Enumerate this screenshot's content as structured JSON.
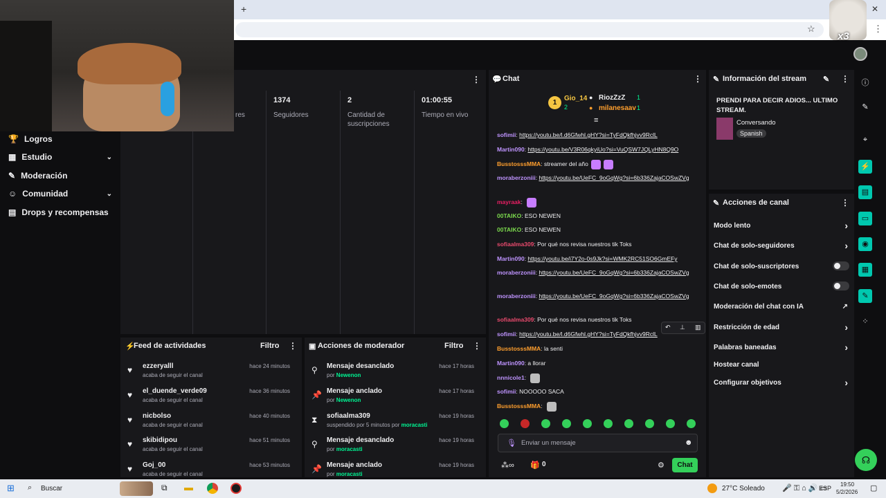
{
  "browser": {
    "new_tab": "+",
    "close": "✕",
    "minimize": "—"
  },
  "sidebar": {
    "items": [
      {
        "label": "Logros",
        "icon": "trophy-icon",
        "chevron": false
      },
      {
        "label": "Estudio",
        "icon": "studio-icon",
        "chevron": true
      },
      {
        "label": "Moderación",
        "icon": "wrench-icon",
        "chevron": false
      },
      {
        "label": "Comunidad",
        "icon": "community-icon",
        "chevron": true
      },
      {
        "label": "Drops y recompensas",
        "icon": "drops-icon",
        "chevron": false
      }
    ]
  },
  "stats": {
    "partial_label": "res",
    "items": [
      {
        "value": "1374",
        "label": "Seguidores"
      },
      {
        "value": "2",
        "label": "Cantidad de suscripciones"
      },
      {
        "value": "01:00:55",
        "label": "Tiempo en vivo"
      }
    ]
  },
  "activity_feed": {
    "title": "Feed de actividades",
    "filter": "Filtro",
    "items": [
      {
        "name": "ezzeryalll",
        "sub": "acaba de seguir el canal",
        "time": "hace 24 minutos"
      },
      {
        "name": "el_duende_verde09",
        "sub": "acaba de seguir el canal",
        "time": "hace 36 minutos"
      },
      {
        "name": "nicbolso",
        "sub": "acaba de seguir el canal",
        "time": "hace 40 minutos"
      },
      {
        "name": "skibidipou",
        "sub": "acaba de seguir el canal",
        "time": "hace 51 minutos"
      },
      {
        "name": "Goj_00",
        "sub": "acaba de seguir el canal",
        "time": "hace 53 minutos"
      }
    ]
  },
  "mod_actions": {
    "title": "Acciones de moderador",
    "filter": "Filtro",
    "items": [
      {
        "title": "Mensaje desanclado",
        "by": "por ",
        "actor": "Newenon",
        "time": "hace 17 horas"
      },
      {
        "title": "Mensaje anclado",
        "by": "por ",
        "actor": "Newenon",
        "time": "hace 17 horas"
      },
      {
        "title": "sofiaalma309",
        "by": "suspendido por 5 minutos por ",
        "actor": "moracasti",
        "time": "hace 19 horas"
      },
      {
        "title": "Mensaje desanclado",
        "by": "por ",
        "actor": "moracasti",
        "time": "hace 19 horas"
      },
      {
        "title": "Mensaje anclado",
        "by": "por ",
        "actor": "moracasti",
        "time": "hace 19 horas"
      }
    ]
  },
  "chat": {
    "title": "Chat",
    "leaderboard": {
      "rank": "1",
      "left_name": "Gio_14",
      "left_count": "2",
      "right": [
        {
          "name": "RiozZzZ",
          "count": "1"
        },
        {
          "name": "milanesaav",
          "count": "1"
        }
      ]
    },
    "messages": [
      {
        "user": "sofimii",
        "color": "#bf94ff",
        "text": "https://youtu.be/l.d6Gfwhl.gHY?si=TyFdQkfhjvv9RclL",
        "link": true
      },
      {
        "user": "Martin090",
        "color": "#bf94ff",
        "text": "https://youtu.be/V3R06qkyiUo?si=VuQSW7JQLyHN8Q9O",
        "link": true
      },
      {
        "user": "BusstosssMMA",
        "color": "#ff9f2e",
        "text": "streamer del año",
        "link": false,
        "emotes": 2
      },
      {
        "user": "moraberzoniii",
        "color": "#bf94ff",
        "text": "https://youtu.be/UeFC_9oGqWg?si=6b336ZajaCOSwZVg",
        "link": true
      },
      {
        "user": "mayraak",
        "color": "#e91e63",
        "text": "",
        "link": false,
        "emotes": 1
      },
      {
        "user": "00TAIKO",
        "color": "#7bd84d",
        "text": "ESO NEWEN",
        "link": false
      },
      {
        "user": "00TAIKO",
        "color": "#7bd84d",
        "text": "ESO NEWEN",
        "link": false
      },
      {
        "user": "sofiaalma309",
        "color": "#e94a6d",
        "text": "Por qué nos revisa nuestros tik Toks",
        "link": false
      },
      {
        "user": "Martin090",
        "color": "#bf94ff",
        "text": "https://youtu.be/i7Y2o-0s9Jk?si=WMK2RC51SO6GmEFy",
        "link": true
      },
      {
        "user": "moraberzoniii",
        "color": "#bf94ff",
        "text": "https://youtu.be/UeFC_9oGqWg?si=6b336ZajaCOSwZVg",
        "link": true
      },
      {
        "user": "moraberzoniii",
        "color": "#bf94ff",
        "text": "https://youtu.be/UeFC_9oGqWg?si=6b336ZajaCOSwZVg",
        "link": true
      },
      {
        "user": "sofiaalma309",
        "color": "#e94a6d",
        "text": "Por qué nos revisa nuestros tik Toks",
        "link": false
      },
      {
        "user": "sofimii",
        "color": "#bf94ff",
        "text": "https://youtu.be/l.d6Gfwhl.gHY?si=TyFdQkfhjvv9RclL",
        "link": true
      },
      {
        "user": "BusstosssMMA",
        "color": "#ff9f2e",
        "text": "la senti",
        "link": false
      },
      {
        "user": "Martin090",
        "color": "#bf94ff",
        "text": "a llorar",
        "link": false
      },
      {
        "user": "nnnicole1",
        "color": "#bf94ff",
        "text": "",
        "link": false,
        "emotes": 1
      },
      {
        "user": "sofimii",
        "color": "#bf94ff",
        "text": "NOOOOO SACA",
        "link": false
      },
      {
        "user": "BusstosssMMA",
        "color": "#ff9f2e",
        "text": "",
        "link": false,
        "emotes": 1
      }
    ],
    "input_placeholder": "Enviar un mensaje",
    "points": "0",
    "chat_button": "Chat"
  },
  "stream_info": {
    "title_label": "Información del stream",
    "stream_title": "PRENDI PARA DECIR ADIOS... ULTIMO STREAM.",
    "category": "Conversando",
    "language": "Spanish"
  },
  "channel_actions": {
    "title": "Acciones de canal",
    "items": [
      {
        "label": "Modo lento",
        "control": "chevron"
      },
      {
        "label": "Chat de solo-seguidores",
        "control": "chevron"
      },
      {
        "label": "Chat de solo-suscriptores",
        "control": "toggle"
      },
      {
        "label": "Chat de solo-emotes",
        "control": "toggle"
      },
      {
        "label": "Moderación del chat con IA",
        "control": "external"
      },
      {
        "label": "Restricción de edad",
        "control": "chevron"
      },
      {
        "label": "Palabras baneadas",
        "control": "chevron"
      },
      {
        "label": "Hostear canal",
        "control": "none"
      },
      {
        "label": "Configurar objetivos",
        "control": "chevron"
      }
    ]
  },
  "overlay": {
    "multiplier": "x3"
  },
  "taskbar": {
    "search": "Buscar",
    "weather": "27°C Soleado",
    "lang": "ESP",
    "time": "19:50",
    "date": "5/2/2026"
  }
}
